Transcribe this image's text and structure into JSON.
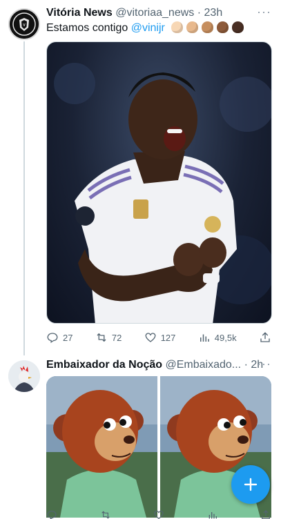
{
  "thread": {
    "tweets": [
      {
        "author_name": "Vitória News",
        "author_handle": "@vitoriaa_news",
        "separator": "·",
        "time": "23h",
        "more_icon": "ellipsis-icon",
        "text": "Estamos contigo",
        "mention": "@vinijr",
        "emoji_colors": [
          "#f7d7b5",
          "#e8b98d",
          "#c68e5e",
          "#8d5a3a",
          "#4a2f24"
        ],
        "avatar_label": "VITÓRIA NEWS",
        "media_icon": "football-player-celebration-image",
        "actions": {
          "replies": "27",
          "retweets": "72",
          "likes": "127",
          "views": "49,5k"
        }
      },
      {
        "author_name": "Embaixador da Noção",
        "author_handle": "@Embaixado...",
        "separator": "·",
        "time": "2h",
        "more_icon": "ellipsis-icon",
        "media_icon": "puppet-meme-image",
        "actions": {
          "replies": "",
          "retweets": "",
          "likes": "",
          "views": ""
        }
      }
    ]
  },
  "fab": {
    "icon": "compose-plus-icon",
    "color": "#1d9bf0"
  },
  "colors": {
    "accent": "#1d9bf0",
    "muted": "#536471",
    "text": "#0f1419"
  }
}
